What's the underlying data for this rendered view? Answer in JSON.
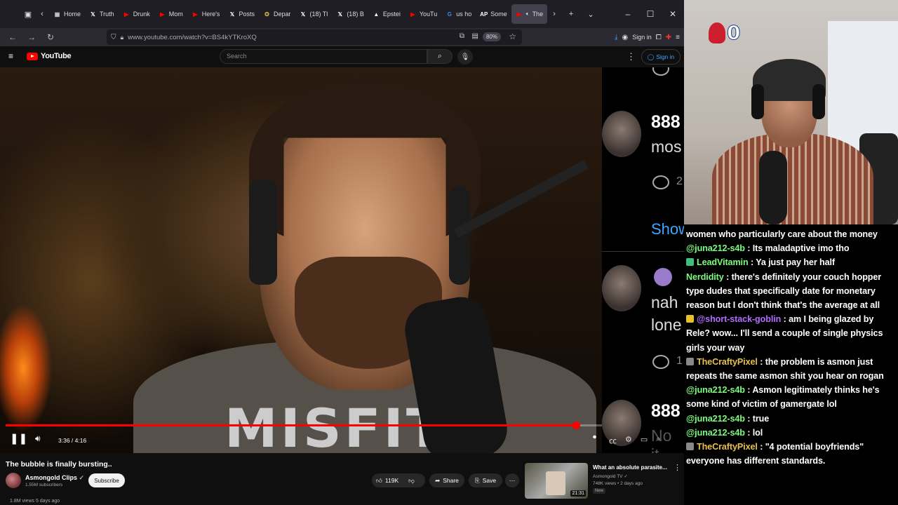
{
  "browser": {
    "tabs": [
      {
        "label": "Home",
        "icon": "calendar-icon",
        "color": "#cccccc"
      },
      {
        "label": "Truth",
        "icon": "x-icon",
        "color": "#ffffff"
      },
      {
        "label": "Drunk",
        "icon": "youtube-icon",
        "color": "#ff0000"
      },
      {
        "label": "Mom",
        "icon": "youtube-icon",
        "color": "#ff0000"
      },
      {
        "label": "Here's",
        "icon": "youtube-icon",
        "color": "#ff0000"
      },
      {
        "label": "Posts",
        "icon": "x-icon",
        "color": "#ffffff"
      },
      {
        "label": "Depar",
        "icon": "seal-icon",
        "color": "#c9a64a"
      },
      {
        "label": "(18) Tl",
        "icon": "x-icon",
        "color": "#ffffff"
      },
      {
        "label": "(18) B",
        "icon": "x-icon",
        "color": "#ffffff"
      },
      {
        "label": "Epstei",
        "icon": "triangle-icon",
        "color": "#ffffff"
      },
      {
        "label": "YouTu",
        "icon": "youtube-icon",
        "color": "#ff0000"
      },
      {
        "label": "us ho",
        "icon": "google-icon",
        "color": "#4285f4"
      },
      {
        "label": "Some",
        "icon": "ap-icon",
        "color": "#ffffff"
      },
      {
        "label": "The",
        "icon": "youtube-icon",
        "color": "#ff0000",
        "active": true
      }
    ],
    "url": "www.youtube.com/watch?v=BS4kYTKroXQ",
    "zoom": "80%",
    "sign_in": "Sign in"
  },
  "youtube": {
    "logo": "YouTube",
    "search_placeholder": "Search",
    "sign_in": "Sign in",
    "video": {
      "current_time": "3:36",
      "duration": "4:16",
      "time_display": "3:36 / 4:16",
      "progress": 0.957,
      "shirt_text": "MISFITS"
    },
    "comments_panel": {
      "items": [
        {
          "num": "888",
          "text": "mos",
          "reply_count": "2"
        },
        {
          "show_more": "Show"
        },
        {
          "num": "",
          "text": "nah",
          "text2": "lone",
          "reply_count": "1"
        },
        {
          "num": "888",
          "text": "No it"
        }
      ]
    },
    "title": "The bubble is finally bursting..",
    "channel": {
      "name": "Asmongold Clips",
      "subs": "1.55M subscribers",
      "subscribe": "Subscribe"
    },
    "actions": {
      "likes": "119K",
      "share": "Share",
      "save": "Save"
    },
    "meta": "1.8M views  5 days ago",
    "recommended": {
      "title": "What an absolute parasite...",
      "channel": "Asmongold TV",
      "meta": "748K views • 2 days ago",
      "badge": "New",
      "duration": "21:31"
    }
  },
  "webcam": {
    "count": "0"
  },
  "chat": [
    {
      "user": "",
      "user_color": "#ffffff",
      "badge": "",
      "text": "women who particularly care about the money",
      "bold_text": true
    },
    {
      "user": "@juna212-s4b",
      "user_color": "#7cfc7c",
      "badge": "",
      "text": " : Its maladaptive imo tho"
    },
    {
      "user": "LeadVitamin",
      "user_color": "#7cfc7c",
      "badge": "#3fbf7f",
      "text": " : Ya just pay her half"
    },
    {
      "user": "Nerdidity",
      "user_color": "#7cfc7c",
      "badge": "",
      "text": " : there's definitely your couch hopper type dudes that specifically date for monetary reason but I don't think that's the average at all"
    },
    {
      "user": "@short-stack-goblin",
      "user_color": "#b26cff",
      "badge": "#e6c12b",
      "text": " : am I being glazed by Rele? wow... I'll send a couple of single physics girls your way"
    },
    {
      "user": "TheCraftyPixel",
      "user_color": "#e8c04a",
      "badge": "#888888",
      "text": " : the problem is asmon just repeats the same asmon shit you hear on rogan"
    },
    {
      "user": "@juna212-s4b",
      "user_color": "#7cfc7c",
      "badge": "",
      "text": " : Asmon legitimately thinks he's some kind of victim of gamergate lol"
    },
    {
      "user": "@juna212-s4b",
      "user_color": "#7cfc7c",
      "badge": "",
      "text": " : true"
    },
    {
      "user": "@juna212-s4b",
      "user_color": "#7cfc7c",
      "badge": "",
      "text": " : lol"
    },
    {
      "user": "TheCraftyPixel",
      "user_color": "#e8c04a",
      "badge": "#888888",
      "text": " : \"4 potential boyfriends\" everyone has different standards."
    }
  ]
}
